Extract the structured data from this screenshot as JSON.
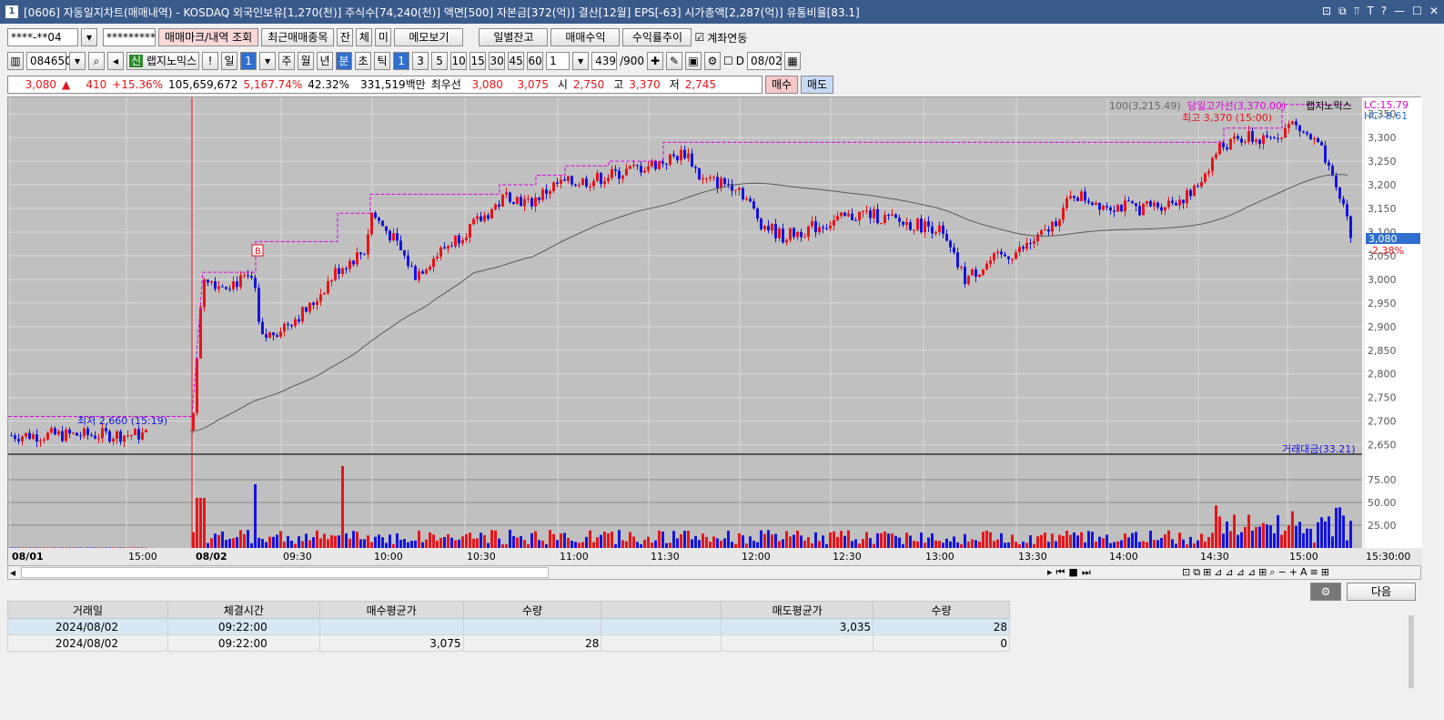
{
  "window": {
    "id_badge": "1",
    "title": "[0606] 자동일지차트(매매내역) - KOSDAQ 외국인보유[1,270(천)] 주식수[74,240(천)] 액면[500] 자본금[372(억)] 결산[12월] EPS[-63] 시가총액[2,287(억)] 유통비율[83.1]",
    "buttons": [
      "⊡",
      "⧉",
      "⫪",
      "T",
      "?",
      "—",
      "☐",
      "✕"
    ]
  },
  "toolbar1": {
    "account": "****-**04",
    "password": "*********",
    "btn_mark": "매매마크/내역 조회",
    "btn_recent": "최근매매종목",
    "tab_jan": "잔",
    "tab_che": "체",
    "tab_mi": "미",
    "btn_memo": "메모보기",
    "btn_daily": "일별잔고",
    "btn_profit": "매매수익",
    "btn_rate": "수익률추이",
    "chk_link": "계좌연동"
  },
  "toolbar2": {
    "code": "084650",
    "stock_badge": "신",
    "stock_name": "랩지노믹스",
    "warn": "!",
    "period_day": "일",
    "day_count": "1",
    "p_week": "주",
    "p_month": "월",
    "p_year": "년",
    "p_min": "분",
    "p_sec": "초",
    "p_tick": "틱",
    "intervals": [
      "1",
      "3",
      "5",
      "10",
      "15",
      "30",
      "45",
      "60"
    ],
    "interval_input": "1",
    "count": "439",
    "count_total": "/900",
    "d_label": "D",
    "date": "08/02"
  },
  "infobar": {
    "price": "3,080",
    "arrow": "▲",
    "change": "410",
    "change_pct": "+15.36%",
    "volume": "105,659,672",
    "vol_pct": "5,167.74%",
    "turnover": "42.32%",
    "amount": "331,519백만",
    "best_label": "최우선",
    "ask": "3,080",
    "bid": "3,075",
    "open_label": "시",
    "open": "2,750",
    "high_label": "고",
    "high": "3,370",
    "low_label": "저",
    "low": "2,745",
    "buy_btn": "매수",
    "sell_btn": "매도"
  },
  "chart_data": {
    "type": "candlestick",
    "subtype": "intraday 1-minute",
    "series_name": "랩지노믹스",
    "ma_label": "100(3,215.49)",
    "hline_label": "당일고가선(3,370.00)",
    "lc": "LC:15.79",
    "hc": "HC:-8.61",
    "high_annot": "최고 3,370 (15:00)",
    "low_annot": "최저 2,660 (15:19)",
    "current_price_tag": "3,080",
    "current_pct_tag": "-2.38%",
    "buy_marker": "B",
    "y_ticks": [
      "3,350",
      "3,300",
      "3,250",
      "3,200",
      "3,150",
      "3,100",
      "3,050",
      "3,000",
      "2,950",
      "2,900",
      "2,850",
      "2,800",
      "2,750",
      "2,700",
      "2,650"
    ],
    "ylim": [
      2630,
      3385
    ],
    "vol_label": "거래대금(33.21)",
    "vol_ticks": [
      "75.00",
      "50.00",
      "25.00"
    ],
    "x_ticks": [
      "08/01",
      "15:00",
      "08/02",
      "09:30",
      "10:00",
      "10:30",
      "11:00",
      "11:30",
      "12:00",
      "12:30",
      "13:00",
      "13:30",
      "14:00",
      "14:30",
      "15:00",
      "15:30:00"
    ],
    "colors": {
      "up": "#e8141a",
      "down": "#1414e0",
      "ma": "#5a5a5a",
      "hline": "#e000e0",
      "bg": "#c0c0c0"
    }
  },
  "tools": {
    "settings_icon": "⚙",
    "next_btn": "다음"
  },
  "grid": {
    "headers": [
      "거래일",
      "체결시간",
      "매수평균가",
      "수량",
      "",
      "매도평균가",
      "수량"
    ],
    "rows": [
      [
        "2024/08/02",
        "09:22:00",
        "",
        "",
        "",
        "3,035",
        "28"
      ],
      [
        "2024/08/02",
        "09:22:00",
        "3,075",
        "28",
        "",
        "",
        "0"
      ]
    ]
  }
}
